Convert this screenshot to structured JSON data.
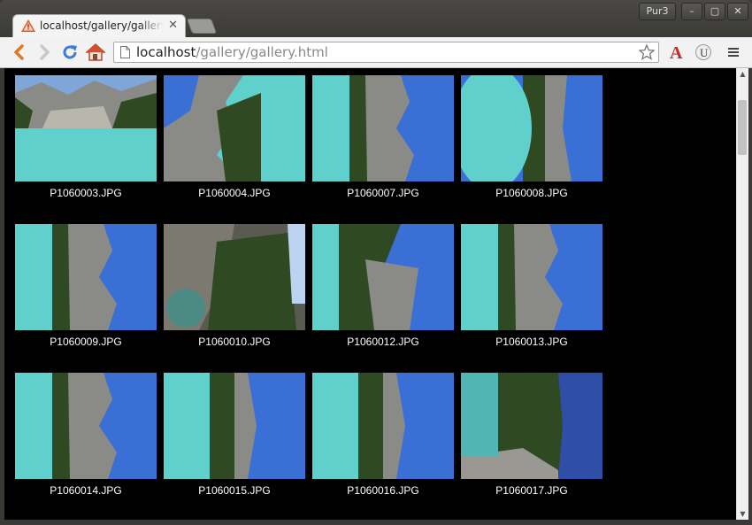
{
  "browser": {
    "tab_title": "localhost/gallery/gallery.html",
    "profile_label": "Pur3",
    "url_host": "localhost",
    "url_path": "/gallery/gallery.html"
  },
  "gallery": {
    "items": [
      {
        "name": "P1060003.JPG",
        "variant": "lake-landscape"
      },
      {
        "name": "P1060004.JPG",
        "variant": "rot-b"
      },
      {
        "name": "P1060007.JPG",
        "variant": "rot-a"
      },
      {
        "name": "P1060008.JPG",
        "variant": "rot-c"
      },
      {
        "name": "P1060009.JPG",
        "variant": "rot-a"
      },
      {
        "name": "P1060010.JPG",
        "variant": "forest"
      },
      {
        "name": "P1060012.JPG",
        "variant": "rot-d"
      },
      {
        "name": "P1060013.JPG",
        "variant": "rot-a"
      },
      {
        "name": "P1060014.JPG",
        "variant": "rot-a"
      },
      {
        "name": "P1060015.JPG",
        "variant": "rot-e"
      },
      {
        "name": "P1060016.JPG",
        "variant": "rot-e"
      },
      {
        "name": "P1060017.JPG",
        "variant": "rot-f"
      }
    ]
  },
  "colors": {
    "lake": "#5fd0cc",
    "sky": "#3a6fd6",
    "rock": "#8a8a86",
    "forest": "#2f4a22"
  }
}
